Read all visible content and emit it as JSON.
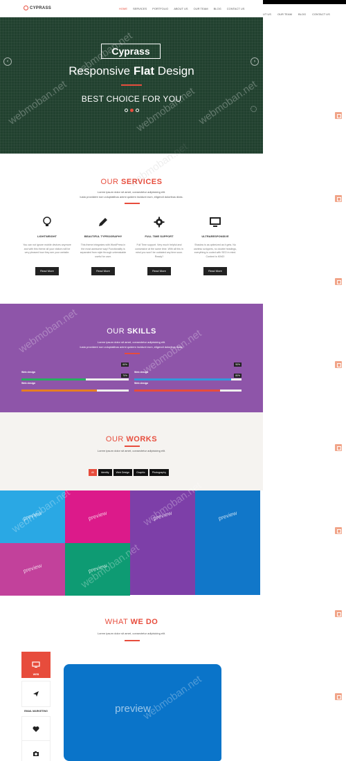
{
  "nav": {
    "logo": "CYPRASS",
    "items": [
      "HOME",
      "SERVICES",
      "PORTFOLIO",
      "ABOUT US",
      "OUR TEAM",
      "BLOG",
      "CONTACT US"
    ],
    "ghost_items": [
      "UT US",
      "OUR TEAM",
      "BLOG",
      "CONTACT US"
    ]
  },
  "hero": {
    "title": "Cyprass",
    "subtitle_a": "Responsive ",
    "subtitle_b": "Flat",
    "subtitle_c": " Design",
    "tagline": "BEST CHOICE FOR YOU",
    "prev": "‹",
    "next": "›"
  },
  "services": {
    "title_a": "OUR ",
    "title_b": "SERVICES",
    "intro_1": "Lorem ipsum dolor sit amet, consectetur adipisicing elit.",
    "intro_2": "Iusto provident non voluptatibus animi quidem incidunt eum, eligendi doloribus dicta.",
    "button": "Read More",
    "items": [
      {
        "title": "LIGHTWEIGHT",
        "icon": "lightbulb-icon",
        "text": "You can not ignore mobile devices anymore and with this theme all your visitors will be very pleased how they see your website."
      },
      {
        "title": "BEAUTIFUL TYPROGRAPHY",
        "icon": "pencil-icon",
        "text": "This theme integrates with WordPress in the most awesome way! Functionality is separated from style through unbreakable useful for user."
      },
      {
        "title": "FULL TIME SUPPORT",
        "icon": "gear-icon",
        "text": "Full Time support. Very much helpful and consessive at the same time. With all this in mind you won't be outdated any time soon. Ready?"
      },
      {
        "title": "ULTRARESPONSIVE",
        "icon": "monitor-icon",
        "text": "Shadow is as optimized as it gets. No useless scrippers, no double headings, everything is coded with SEO in mind. Content is KING!"
      }
    ]
  },
  "skills": {
    "title_a": "OUR ",
    "title_b": "SKILLS",
    "intro_1": "Lorem ipsum dolor sit amet, consectetur adipisicing elit.",
    "intro_2": "Iusto provident non voluptatibus animi quidem incidunt eum, eligendi doloribus dicta.",
    "items": [
      {
        "label": "Web design",
        "pct_label": "60%",
        "level": 0.6,
        "color": "#27ae60"
      },
      {
        "label": "Web design",
        "pct_label": "90%",
        "level": 0.9,
        "color": "#3498db"
      },
      {
        "label": "Web design",
        "pct_label": "70%",
        "level": 0.7,
        "color": "#e67e22"
      },
      {
        "label": "Web design",
        "pct_label": "80%",
        "level": 0.8,
        "color": "#e74c3c"
      }
    ]
  },
  "works": {
    "title_a": "OUR ",
    "title_b": "WORKS",
    "intro": "Lorem ipsum dolor sit amet, consectetur adipisicing elit.",
    "filters": [
      "All",
      "Identity",
      "Web Design",
      "Graphic",
      "Photography"
    ],
    "tiles": [
      {
        "label": "preview",
        "color": "#2aa8e4"
      },
      {
        "label": "preview",
        "color": "#dc1a8a"
      },
      {
        "label": "preview",
        "color": "#7d3fa8"
      },
      {
        "label": "preview",
        "color": "#1177c9"
      },
      {
        "label": "preview",
        "color": "#c2419b"
      },
      {
        "label": "preview",
        "color": "#0e9b73"
      },
      {
        "label": "",
        "color": "#7d3fa8"
      },
      {
        "label": "",
        "color": "#1177c9"
      }
    ]
  },
  "what_we_do": {
    "title_a": "WHAT ",
    "title_b": "WE DO",
    "intro": "Lorem ipsum dolor sit amet, consectetur adipisicing elit.",
    "items": [
      {
        "label": "WEB",
        "icon": "desktop-icon"
      },
      {
        "label": "EMAIL MARKETING",
        "icon": "paper-plane-icon"
      },
      {
        "label": "GRAPHICS",
        "icon": "heart-icon"
      },
      {
        "label": "",
        "icon": "camera-icon"
      }
    ],
    "preview_label": "preview"
  },
  "colors": {
    "accent": "#e74c3c",
    "hero_bg": "#21412f",
    "skills_bg": "#8e55a9",
    "works_bg": "#f5f3f0"
  }
}
